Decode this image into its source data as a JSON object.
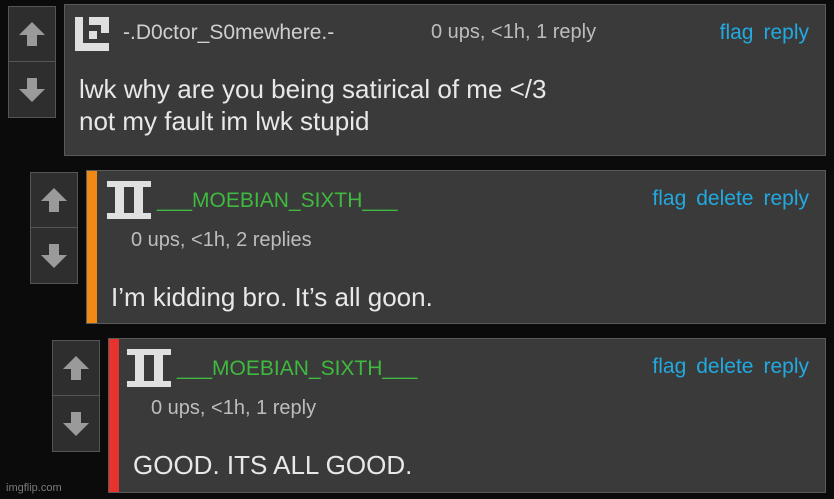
{
  "comments": [
    {
      "username": "-.D0ctor_S0mewhere.-",
      "username_color": "#cfcfcf",
      "meta": "0 ups, <1h, 1 reply",
      "actions": [
        "flag",
        "reply"
      ],
      "body": [
        "lwk why are you being satirical of me </3",
        "not my fault im lwk stupid"
      ]
    },
    {
      "username": "___MOEBIAN_SIXTH___",
      "username_color": "#3fb93f",
      "stripe_color": "#f08a14",
      "meta": "0 ups, <1h, 2 replies",
      "actions": [
        "flag",
        "delete",
        "reply"
      ],
      "body": [
        "I’m kidding bro. It’s all goon."
      ]
    },
    {
      "username": "___MOEBIAN_SIXTH___",
      "username_color": "#3fb93f",
      "stripe_color": "#e8322e",
      "meta": "0 ups, <1h, 1 reply",
      "actions": [
        "flag",
        "delete",
        "reply"
      ],
      "body": [
        "GOOD. ITS ALL GOOD."
      ]
    }
  ],
  "vote_icons": [
    "up-arrow-icon",
    "down-arrow-icon"
  ],
  "accent_color": "#22a9e0",
  "watermark": "imgflip.com"
}
